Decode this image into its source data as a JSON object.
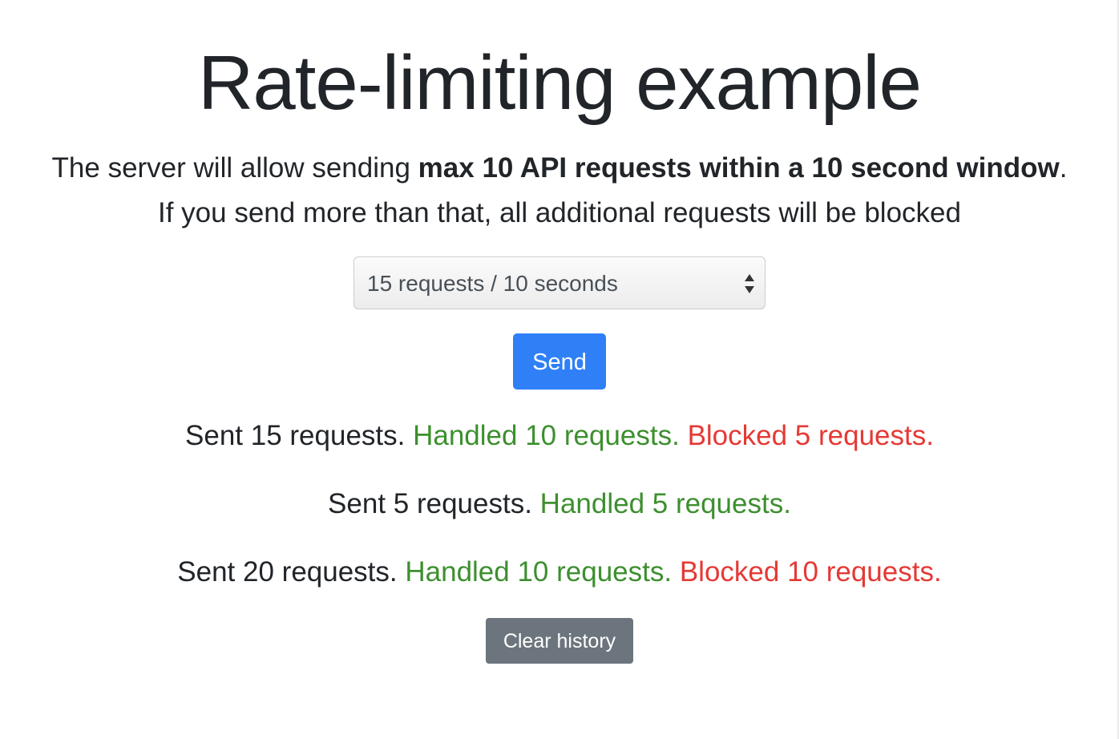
{
  "header": {
    "title": "Rate-limiting example"
  },
  "intro": {
    "line1_prefix": "The server will allow sending ",
    "line1_bold": "max 10 API requests within a 10 second window",
    "line1_suffix": ".",
    "line2": "If you send more than that, all additional requests will be blocked"
  },
  "form": {
    "select_value": "15 requests / 10 seconds",
    "send_label": "Send"
  },
  "results": [
    {
      "sent": "Sent 15 requests.",
      "handled": "Handled 10 requests.",
      "blocked": "Blocked 5 requests."
    },
    {
      "sent": "Sent 5 requests.",
      "handled": "Handled 5 requests.",
      "blocked": ""
    },
    {
      "sent": "Sent 20 requests.",
      "handled": "Handled 10 requests.",
      "blocked": "Blocked 10 requests."
    }
  ],
  "actions": {
    "clear_label": "Clear history"
  },
  "colors": {
    "primary": "#2f80f7",
    "secondary": "#6c757d",
    "success": "#3d8f2f",
    "danger": "#e53935",
    "text": "#212529"
  },
  "icons": {
    "select_arrows": "updown-chevron-icon"
  }
}
